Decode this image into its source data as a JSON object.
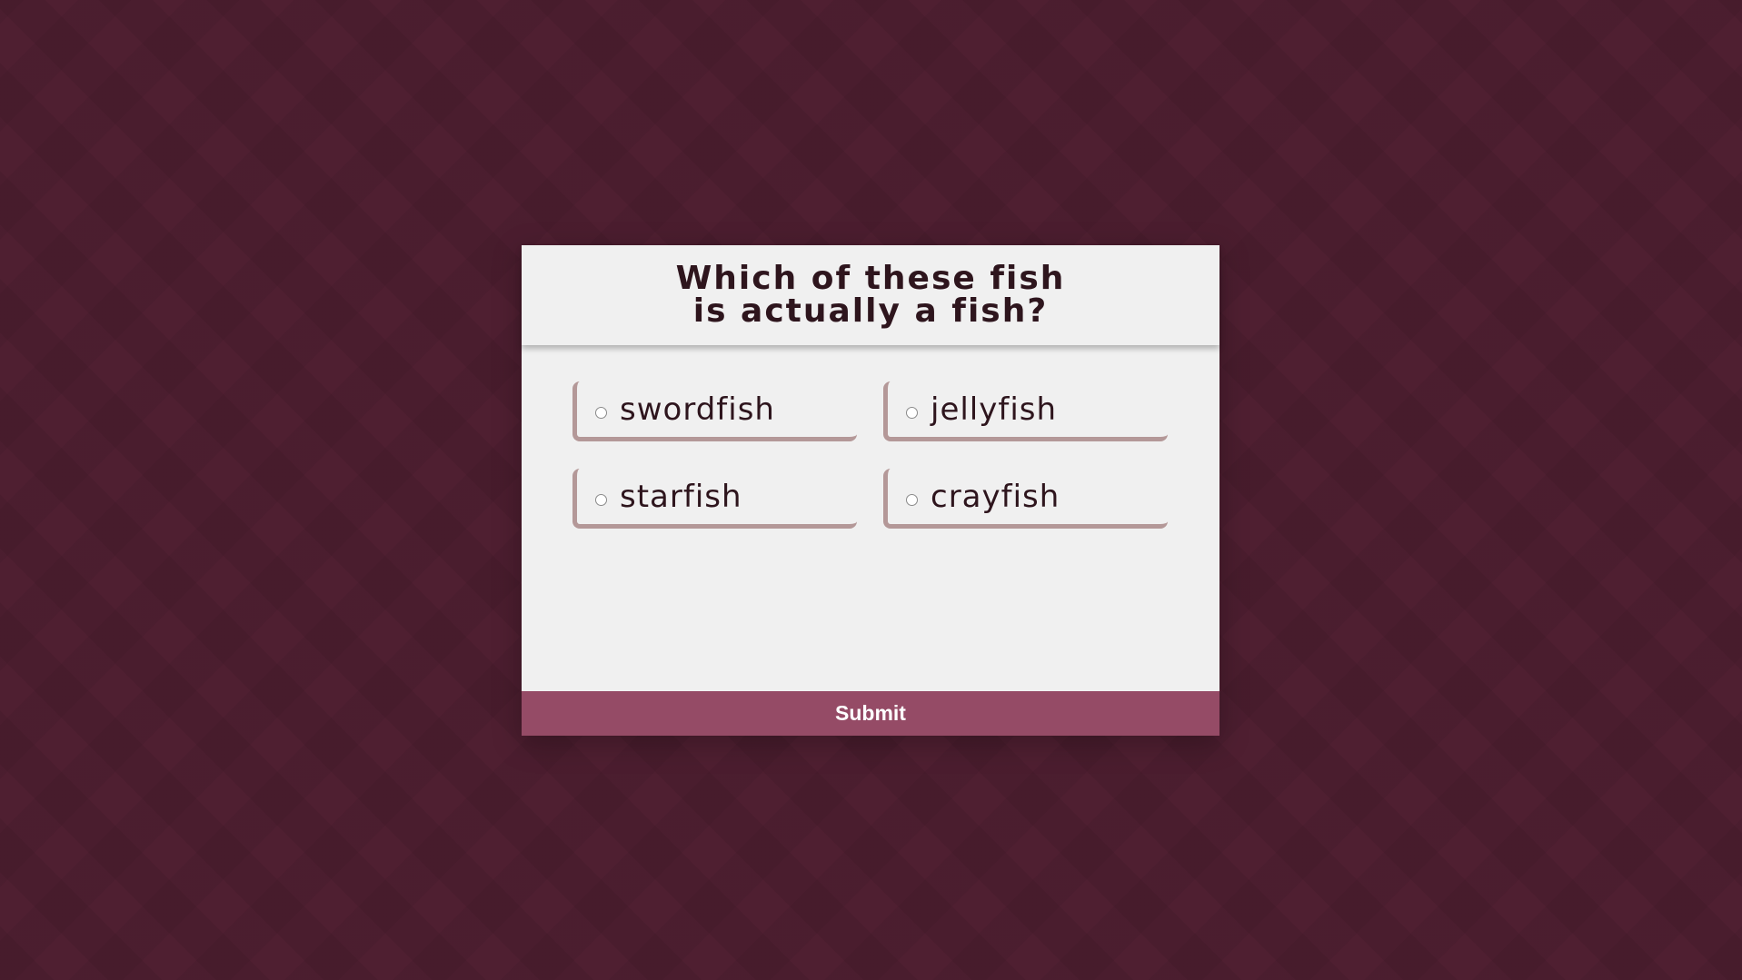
{
  "question": {
    "title": "Which of these fish is actually a fish?"
  },
  "answers": [
    {
      "label": "swordfish",
      "selected": false
    },
    {
      "label": "jellyfish",
      "selected": false
    },
    {
      "label": "starfish",
      "selected": false
    },
    {
      "label": "crayfish",
      "selected": false
    }
  ],
  "submit": {
    "label": "Submit"
  },
  "colors": {
    "background": "#4f1f31",
    "card": "#f0f0f0",
    "option_border": "#b49898",
    "submit_button": "#954b66",
    "text": "#2e151d"
  }
}
